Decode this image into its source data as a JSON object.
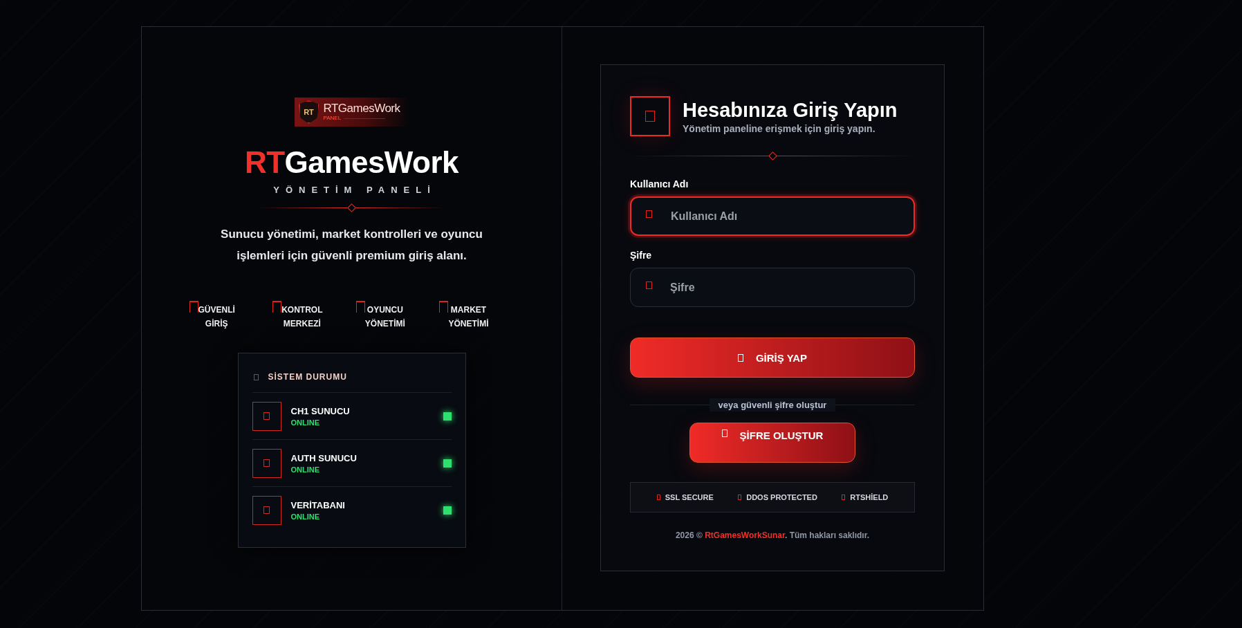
{
  "brand": {
    "logo": {
      "mark": "RT",
      "name": "RTGamesWork",
      "sub": "PANEL"
    },
    "title_accent": "RT",
    "title_rest": "GamesWork",
    "subtitle": "YÖNETİM PANELİ",
    "description": "Sunucu yönetimi, market kontrolleri ve oyuncu işlemleri için güvenli premium giriş alanı."
  },
  "features": [
    {
      "line1": "GÜVENLİ",
      "line2": "GİRİŞ"
    },
    {
      "line1": "KONTROL",
      "line2": "MERKEZİ"
    },
    {
      "line1": "OYUNCU",
      "line2": "YÖNETİMİ"
    },
    {
      "line1": "MARKET",
      "line2": "YÖNETİMİ"
    }
  ],
  "system_status": {
    "title": "SİSTEM DURUMU",
    "items": [
      {
        "name": "CH1 SUNUCU",
        "status": "ONLINE",
        "color": "#2ee06e"
      },
      {
        "name": "AUTH SUNUCU",
        "status": "ONLINE",
        "color": "#2ee06e"
      },
      {
        "name": "VERİTABANI",
        "status": "ONLINE",
        "color": "#2ee06e"
      }
    ]
  },
  "login": {
    "title": "Hesabınıza Giriş Yapın",
    "subtitle": "Yönetim paneline erişmek için giriş yapın.",
    "fields": [
      {
        "label": "Kullanıcı Adı",
        "placeholder": "Kullanıcı Adı",
        "focused": true
      },
      {
        "label": "Şifre",
        "placeholder": "Şifre",
        "focused": false
      }
    ],
    "submit": "GİRİŞ YAP",
    "separator": "veya güvenli şifre oluştur",
    "create": "ŞİFRE OLUŞTUR",
    "badges": [
      "SSL SECURE",
      "DDOS PROTECTED",
      "RTSHİELD"
    ],
    "footer": {
      "before": "2026 © ",
      "link": "RtGamesWorkSunar",
      "after": ". Tüm hakları saklıdır."
    }
  }
}
